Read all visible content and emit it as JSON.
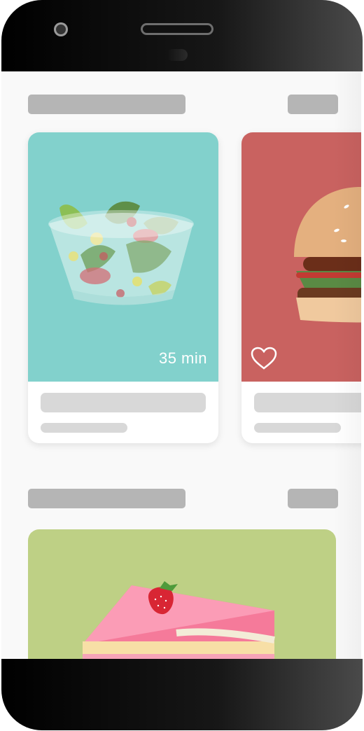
{
  "cards": [
    {
      "time_label": "35 min",
      "image": "salad-bowl",
      "bg_color": "#82d1cc"
    },
    {
      "image": "burger",
      "bg_color": "#c96260",
      "favorite_icon": "heart-outline-icon"
    }
  ],
  "featured": {
    "image": "strawberry-cake-slice",
    "bg_color": "#bed085"
  }
}
